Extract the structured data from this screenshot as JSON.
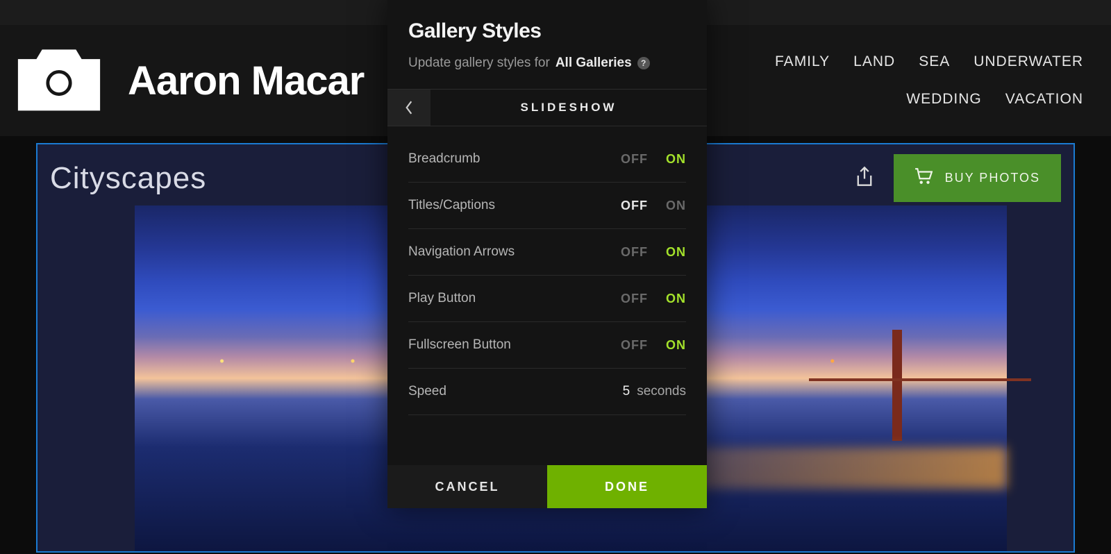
{
  "brand": {
    "name": "Aaron Macar"
  },
  "nav": {
    "items": [
      "FAMILY",
      "LAND",
      "SEA",
      "UNDERWATER",
      "WEDDING",
      "VACATION"
    ]
  },
  "gallery": {
    "title": "Cityscapes",
    "buy_label": "BUY PHOTOS"
  },
  "modal": {
    "title": "Gallery Styles",
    "subtitle_prefix": "Update gallery styles for ",
    "subtitle_scope": "All Galleries",
    "section": "SLIDESHOW",
    "off": "OFF",
    "on": "ON",
    "rows": {
      "breadcrumb": {
        "label": "Breadcrumb",
        "value": "ON"
      },
      "titles": {
        "label": "Titles/Captions",
        "value": "OFF"
      },
      "navarrows": {
        "label": "Navigation Arrows",
        "value": "ON"
      },
      "playbutton": {
        "label": "Play Button",
        "value": "ON"
      },
      "fullscreen": {
        "label": "Fullscreen Button",
        "value": "ON"
      }
    },
    "speed": {
      "label": "Speed",
      "value": "5",
      "unit": "seconds"
    },
    "cancel": "CANCEL",
    "done": "DONE"
  }
}
